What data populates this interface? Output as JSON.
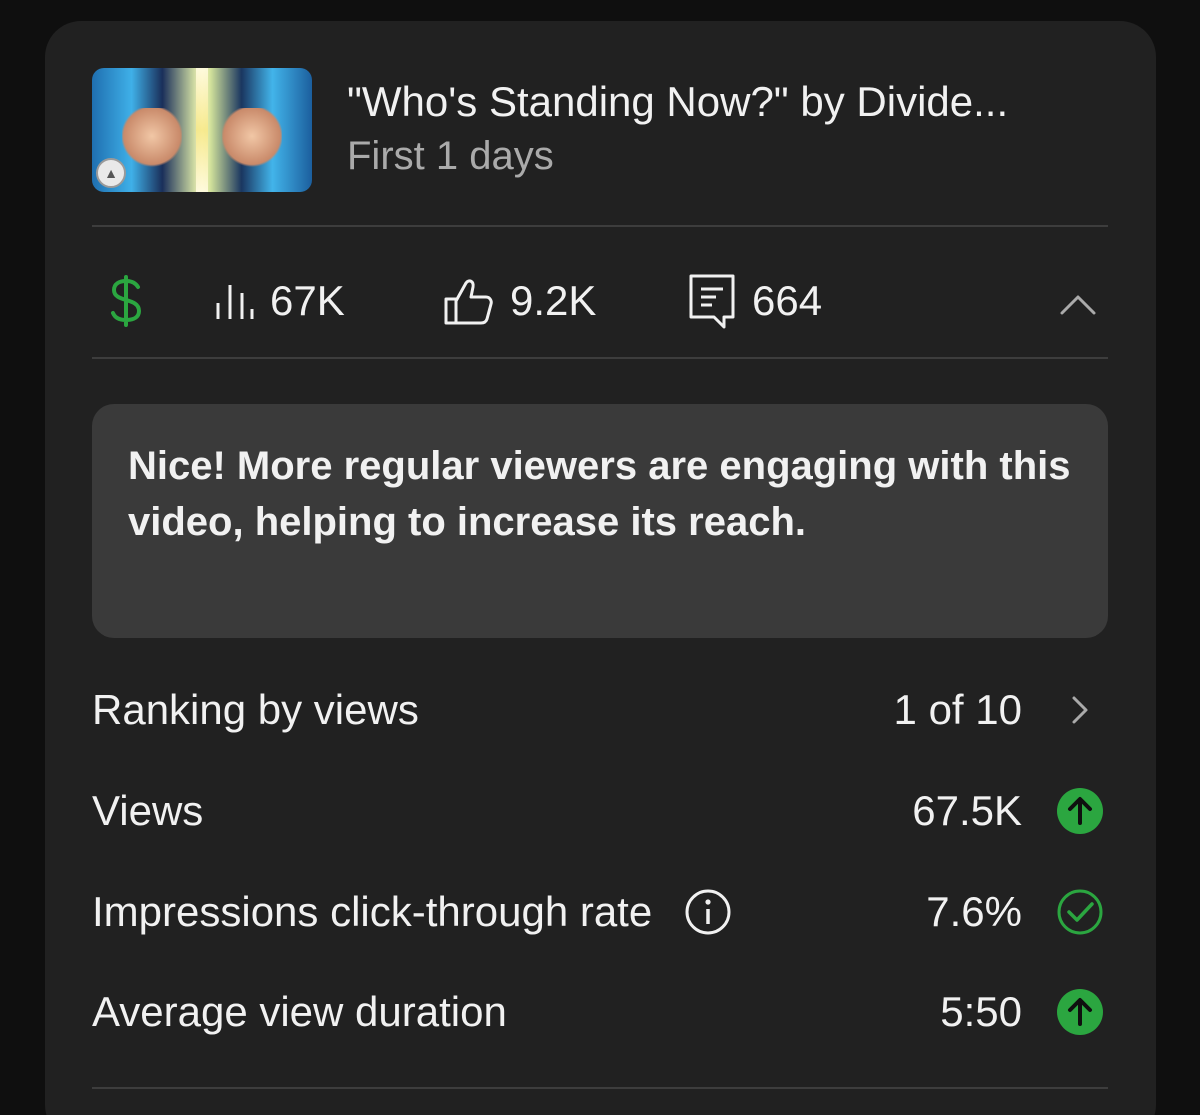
{
  "video": {
    "title": "\"Who's Standing Now?\" by Divide...",
    "subtitle": "First 1 days"
  },
  "stats": {
    "views": "67K",
    "likes": "9.2K",
    "comments": "664"
  },
  "banner": {
    "text": "Nice! More regular viewers are engaging with this video, helping to increase its reach."
  },
  "metrics": [
    {
      "label": "Ranking by views",
      "value": "1 of 10",
      "status": "chevron-right-icon"
    },
    {
      "label": "Views",
      "value": "67.5K",
      "status": "arrow-up-icon"
    },
    {
      "label": "Impressions click-through rate",
      "value": "7.6%",
      "status": "check-circle-icon"
    },
    {
      "label": "Average view duration",
      "value": "5:50",
      "status": "arrow-up-icon"
    }
  ],
  "colors": {
    "background": "#0f0f0f",
    "card": "#212121",
    "banner": "#3a3a3a",
    "positive": "#2ba640",
    "text": "#f1f1f1",
    "secondary_text": "#aaaaaa"
  }
}
